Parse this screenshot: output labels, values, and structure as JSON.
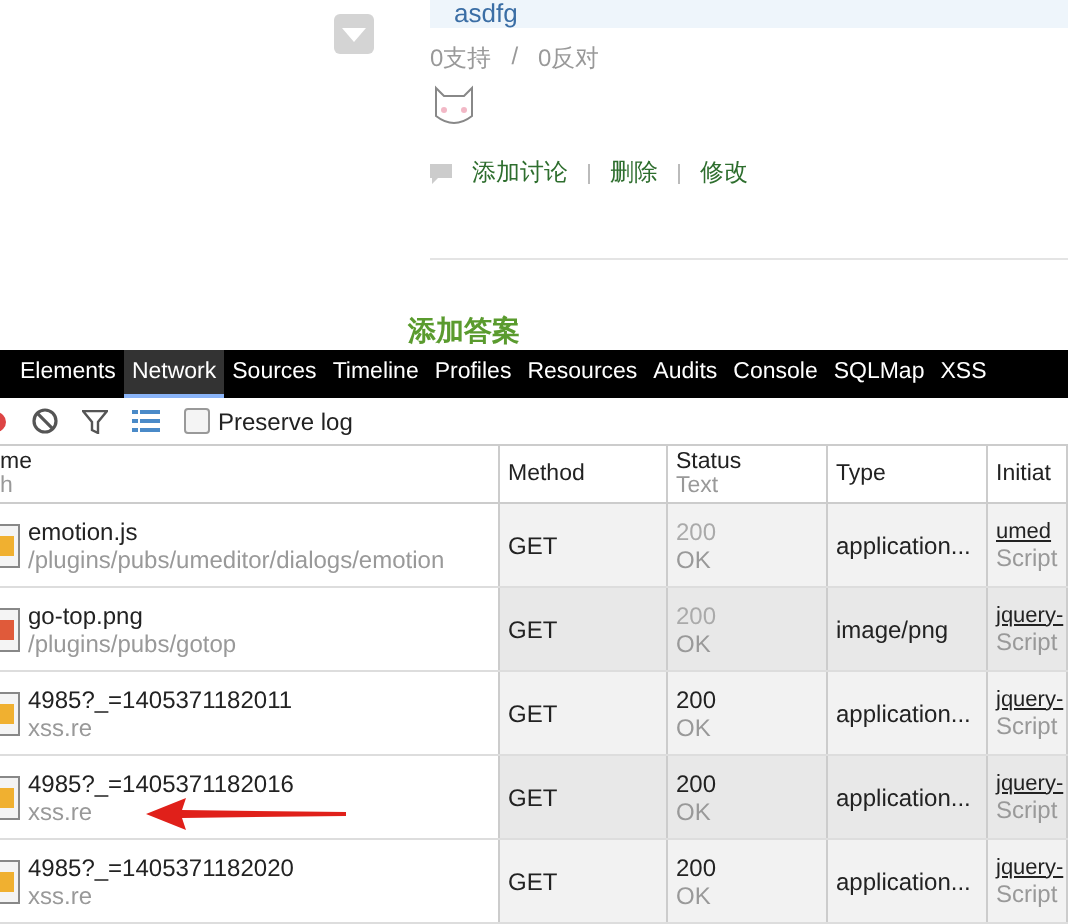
{
  "answer": {
    "author": "asdfg",
    "votes": [
      {
        "label": "0支持"
      },
      {
        "label": "0反对"
      }
    ],
    "vote_separator": "/",
    "actions": [
      {
        "label": "添加讨论"
      },
      {
        "label": "删除"
      },
      {
        "label": "修改"
      }
    ]
  },
  "add_answer": {
    "title": "添加答案"
  },
  "devtools": {
    "tabs": [
      {
        "label": "Elements",
        "selected": false
      },
      {
        "label": "Network",
        "selected": true
      },
      {
        "label": "Sources",
        "selected": false
      },
      {
        "label": "Timeline",
        "selected": false
      },
      {
        "label": "Profiles",
        "selected": false
      },
      {
        "label": "Resources",
        "selected": false
      },
      {
        "label": "Audits",
        "selected": false
      },
      {
        "label": "Console",
        "selected": false
      },
      {
        "label": "SQLMap",
        "selected": false
      },
      {
        "label": "XSS",
        "selected": false
      }
    ],
    "preserve_log": {
      "label": "Preserve log",
      "checked": false
    },
    "columns": [
      {
        "title": "me",
        "subtitle": "h"
      },
      {
        "title": "Method"
      },
      {
        "title": "Status",
        "subtitle": "Text"
      },
      {
        "title": "Type"
      },
      {
        "title": "Initiat"
      }
    ],
    "rows": [
      {
        "kind": "script",
        "name": "emotion.js",
        "path": "/plugins/pubs/umeditor/dialogs/emotion",
        "method": "GET",
        "status": "200",
        "status_text": "OK",
        "type": "application...",
        "initiator": "umed",
        "initiator_type": "Script",
        "faded": true
      },
      {
        "kind": "image",
        "name": "go-top.png",
        "path": "/plugins/pubs/gotop",
        "method": "GET",
        "status": "200",
        "status_text": "OK",
        "type": "image/png",
        "initiator": "jquery-",
        "initiator_type": "Script",
        "faded": true
      },
      {
        "kind": "script",
        "name": "4985?_=1405371182011",
        "path": "xss.re",
        "method": "GET",
        "status": "200",
        "status_text": "OK",
        "type": "application...",
        "initiator": "jquery-",
        "initiator_type": "Script",
        "faded": false
      },
      {
        "kind": "script",
        "name": "4985?_=1405371182016",
        "path": "xss.re",
        "method": "GET",
        "status": "200",
        "status_text": "OK",
        "type": "application...",
        "initiator": "jquery-",
        "initiator_type": "Script",
        "faded": false,
        "pointed": true
      },
      {
        "kind": "script",
        "name": "4985?_=1405371182020",
        "path": "xss.re",
        "method": "GET",
        "status": "200",
        "status_text": "OK",
        "type": "application...",
        "initiator": "jquery-",
        "initiator_type": "Script",
        "faded": false
      }
    ]
  }
}
